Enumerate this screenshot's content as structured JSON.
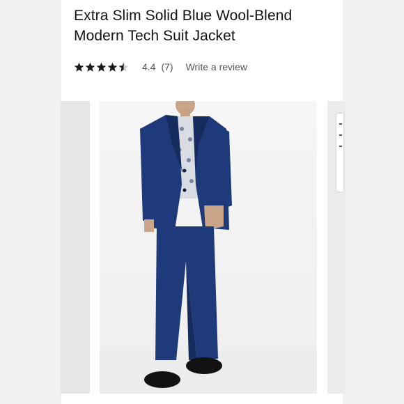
{
  "product": {
    "title_line1": "Extra Slim Solid Blue Wool-Blend",
    "title_line2": "Modern Tech Suit Jacket",
    "rating_value": "4.4",
    "rating_stars": 4.4,
    "rating_count": "(7)",
    "write_review_label": "Write a review"
  },
  "colors": {
    "suit": "#1f3a7a",
    "suit_shadow": "#162c5e",
    "shoes": "#121212",
    "star": "#1a1a1a"
  },
  "carousel": {
    "main_image_alt": "Model wearing blue suit"
  }
}
